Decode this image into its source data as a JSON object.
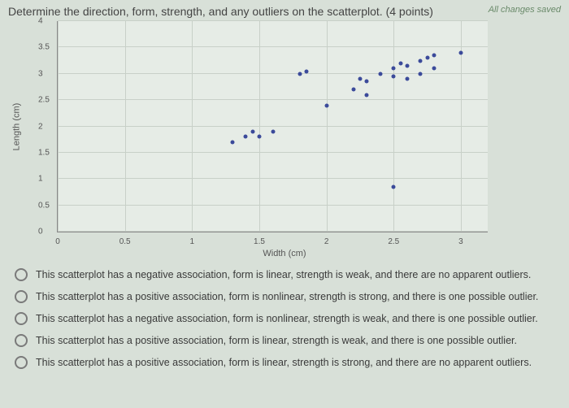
{
  "header": {
    "question": "Determine the direction, form, strength, and any outliers on the scatterplot. (4 points)",
    "saved": "All changes saved"
  },
  "chart_data": {
    "type": "scatter",
    "title": "",
    "xlabel": "Width (cm)",
    "ylabel": "Length (cm)",
    "xlim": [
      0,
      3.2
    ],
    "ylim": [
      0,
      4
    ],
    "xticks": [
      0,
      0.5,
      1,
      1.5,
      2,
      2.5,
      3
    ],
    "yticks": [
      0,
      0.5,
      1,
      1.5,
      2,
      2.5,
      3,
      3.5,
      4
    ],
    "points": [
      [
        1.3,
        1.7
      ],
      [
        1.4,
        1.8
      ],
      [
        1.45,
        1.9
      ],
      [
        1.5,
        1.8
      ],
      [
        1.6,
        1.9
      ],
      [
        1.8,
        3.0
      ],
      [
        1.85,
        3.05
      ],
      [
        2.0,
        2.4
      ],
      [
        2.2,
        2.7
      ],
      [
        2.25,
        2.9
      ],
      [
        2.3,
        2.6
      ],
      [
        2.3,
        2.85
      ],
      [
        2.4,
        3.0
      ],
      [
        2.5,
        2.95
      ],
      [
        2.5,
        3.1
      ],
      [
        2.55,
        3.2
      ],
      [
        2.6,
        2.9
      ],
      [
        2.6,
        3.15
      ],
      [
        2.7,
        3.0
      ],
      [
        2.7,
        3.25
      ],
      [
        2.75,
        3.3
      ],
      [
        2.8,
        3.1
      ],
      [
        2.8,
        3.35
      ],
      [
        3.0,
        3.4
      ],
      [
        2.5,
        0.85
      ]
    ]
  },
  "options": {
    "a": "This scatterplot has a negative association, form is linear, strength is weak, and there are no apparent outliers.",
    "b": "This scatterplot has a positive association, form is nonlinear, strength is strong, and there is one possible outlier.",
    "c": "This scatterplot has a negative association, form is nonlinear, strength is weak, and there is one possible outlier.",
    "d": "This scatterplot has a positive association, form is linear, strength is weak, and there is one possible outlier.",
    "e": "This scatterplot has a positive association, form is linear, strength is strong, and there are no apparent outliers."
  }
}
